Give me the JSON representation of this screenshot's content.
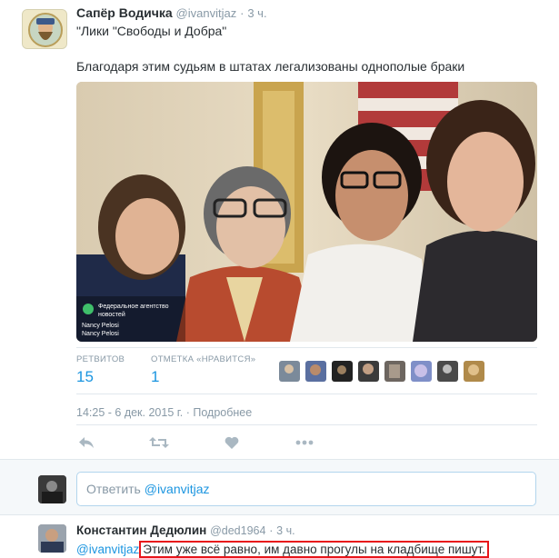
{
  "tweet": {
    "author_name": "Сапёр Водичка",
    "author_handle": "@ivanvitjaz",
    "dot": "·",
    "time": "3 ч.",
    "line1": "\"Лики \"Свободы и Добра\"",
    "line2": "Благодаря этим судьям в штатах легализованы однополые браки",
    "photo": {
      "watermark_line1": "Федеральное агентство",
      "watermark_line2": "новостей",
      "caption1": "Nancy Pelosi",
      "caption2": "Nancy Pelosi"
    },
    "stats": {
      "retweets_label": "РЕТВИТОВ",
      "retweets_value": "15",
      "likes_label": "ОТМЕТКА «НРАВИТСЯ»",
      "likes_value": "1"
    },
    "timestamp": "14:25 - 6 дек. 2015 г.",
    "details_link": "Подробнее"
  },
  "reply_box": {
    "prefix": "Ответить ",
    "mention": "@ivanvitjaz"
  },
  "reply": {
    "author_name": "Константин Дедюлин",
    "author_handle": "@ded1964",
    "dot": "·",
    "time": "3 ч.",
    "mention": "@ivanvitjaz",
    "text": "Этим уже всё равно, им давно прогулы на кладбище пишут."
  },
  "icons": [
    "reply-icon",
    "retweet-icon",
    "like-icon",
    "more-icon"
  ],
  "colors": {
    "link": "#1b95e0",
    "muted": "#8899a6",
    "highlight_box": "#e8151b"
  }
}
